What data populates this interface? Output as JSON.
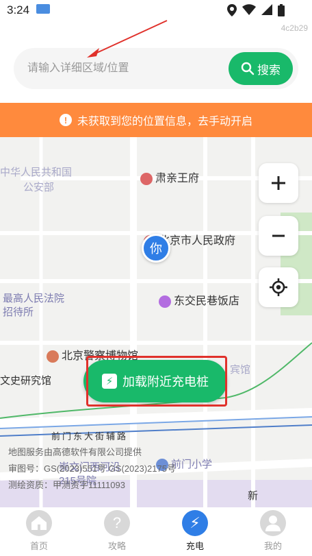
{
  "status_bar": {
    "time": "3:24"
  },
  "build_tag": "4c2b29",
  "search": {
    "placeholder": "请输入详细区域/位置",
    "button_label": "搜索"
  },
  "location_banner": {
    "message": "未获取到您的位置信息，去手动开启"
  },
  "map": {
    "labels": [
      "中华人民共和国",
      "公安部",
      "肃亲王府",
      "北京市人民政府",
      "最高人民法院",
      "招待所",
      "东交民巷饭店",
      "北京警察博物馆",
      "文史研究馆",
      "宾馆",
      "前门东大街辅路",
      "前门小学",
      "崇文门西河沿",
      "215号院",
      "新"
    ],
    "user_marker_label": "你",
    "load_button_label": "加载附近充电桩",
    "attribution": {
      "line1": "地图服务由高德软件有限公司提供",
      "line2": "审图号：GS(2023)551号 GS(2023)2175号",
      "line3": "测绘资质：甲测资字11111093"
    }
  },
  "bottom_nav": [
    {
      "label": "首页",
      "icon": "home-icon",
      "active": false
    },
    {
      "label": "攻略",
      "icon": "help-icon",
      "active": false
    },
    {
      "label": "充电",
      "icon": "bolt-icon",
      "active": true
    },
    {
      "label": "我的",
      "icon": "user-icon",
      "active": false
    }
  ],
  "colors": {
    "accent_green": "#19b96a",
    "banner_orange": "#ff8a3d",
    "active_blue": "#2f7ee6",
    "highlight_red": "#e0312b"
  }
}
